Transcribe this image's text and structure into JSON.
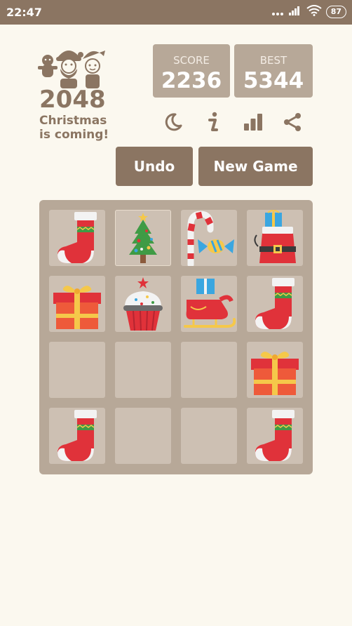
{
  "status": {
    "time": "22:47",
    "battery": "87"
  },
  "header": {
    "title": "2048",
    "subtitle_line1": "Christmas",
    "subtitle_line2": "is coming!"
  },
  "score": {
    "label": "SCORE",
    "value": "2236"
  },
  "best": {
    "label": "BEST",
    "value": "5344"
  },
  "toolbar": {
    "icons": [
      "moon-icon",
      "info-icon",
      "leaderboard-icon",
      "share-icon"
    ]
  },
  "buttons": {
    "undo": "Undo",
    "new_game": "New Game"
  },
  "board": {
    "size": 4,
    "rows": [
      [
        "stocking",
        "tree",
        "candy",
        "santa-bag"
      ],
      [
        "gift",
        "cupcake",
        "sleigh",
        "stocking"
      ],
      [
        "",
        "",
        "",
        "gift"
      ],
      [
        "stocking",
        "",
        "",
        "stocking"
      ]
    ]
  },
  "colors": {
    "accent": "#8b7562",
    "board": "#b7a898",
    "cell": "#cdc0b3",
    "background": "#fbf8ef"
  }
}
